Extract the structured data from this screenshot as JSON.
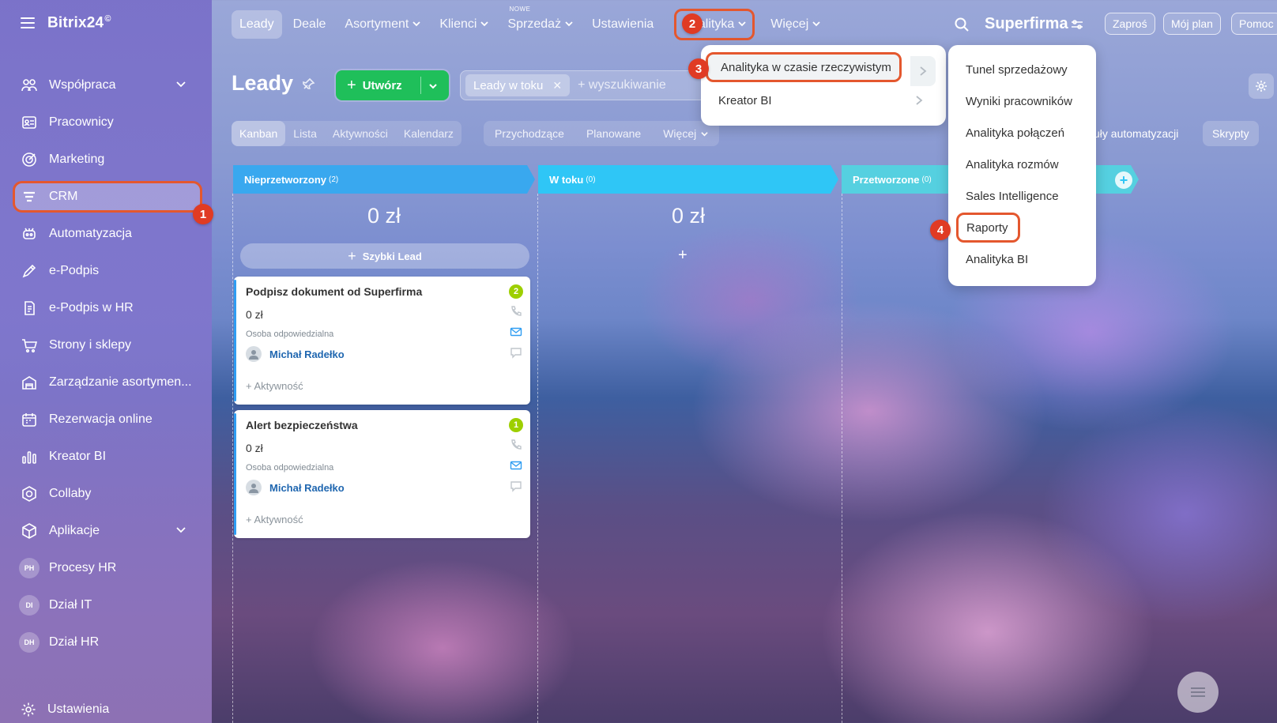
{
  "sidebar": {
    "brand": "Bitrix24",
    "brand_mark": "©",
    "items": [
      {
        "label": "Współpraca",
        "icon": "collaboration-icon",
        "has_chevron": true
      },
      {
        "label": "Pracownicy",
        "icon": "employees-icon"
      },
      {
        "label": "Marketing",
        "icon": "marketing-icon"
      },
      {
        "label": "CRM",
        "icon": "crm-icon",
        "active": true
      },
      {
        "label": "Automatyzacja",
        "icon": "automation-icon"
      },
      {
        "label": "e-Podpis",
        "icon": "signature-icon"
      },
      {
        "label": "e-Podpis w HR",
        "icon": "hr-signature-icon"
      },
      {
        "label": "Strony i sklepy",
        "icon": "cart-icon"
      },
      {
        "label": "Zarządzanie asortymen...",
        "icon": "inventory-icon"
      },
      {
        "label": "Rezerwacja online",
        "icon": "calendar-icon"
      },
      {
        "label": "Kreator BI",
        "icon": "bar-chart-icon"
      },
      {
        "label": "Collaby",
        "icon": "collaby-icon"
      },
      {
        "label": "Aplikacje",
        "icon": "apps-icon",
        "has_chevron": true
      },
      {
        "label": "Procesy HR",
        "initials": "PH"
      },
      {
        "label": "Dział IT",
        "initials": "DI"
      },
      {
        "label": "Dział HR",
        "initials": "DH"
      }
    ],
    "settings_label": "Ustawienia"
  },
  "steps": [
    "1",
    "2",
    "3",
    "4"
  ],
  "topnav": {
    "items": [
      "Leady",
      "Deale",
      "Asortyment",
      "Klienci",
      "Sprzedaż",
      "Ustawienia",
      "Analityka",
      "Więcej"
    ],
    "new_tag": "NOWE",
    "company": "Superfirma",
    "buttons": [
      "Zaproś",
      "Mój plan",
      "Pomoc"
    ]
  },
  "toolbar": {
    "title": "Leady",
    "create_label": "Utwórz",
    "filter_chip": "Leady w toku",
    "search_placeholder": "+ wyszukiwanie",
    "view_tabs": [
      "Kanban",
      "Lista",
      "Aktywności",
      "Kalendarz"
    ],
    "mode_tabs": [
      "Przychodzące",
      "Planowane",
      "Więcej"
    ],
    "automation_label": "uły automatyzacji",
    "scripts_label": "Skrypty"
  },
  "kanban": {
    "columns": [
      {
        "name": "Nieprzetworzony",
        "count": "(2)",
        "color": "#39a8ef",
        "sum": "0 zł"
      },
      {
        "name": "W toku",
        "count": "(0)",
        "color": "#2fc6f6",
        "sum": "0 zł"
      },
      {
        "name": "Przetworzone",
        "count": "(0)",
        "color": "#55d0e0"
      }
    ],
    "quick_lead": "Szybki Lead",
    "cards": [
      {
        "title": "Podpisz dokument od Superfirma",
        "badge": "2",
        "amount": "0 zł",
        "responsible_label": "Osoba odpowiedzialna",
        "user": "Michał Radełko",
        "activity": "+ Aktywność"
      },
      {
        "title": "Alert bezpieczeństwa",
        "badge": "1",
        "amount": "0 zł",
        "responsible_label": "Osoba odpowiedzialna",
        "user": "Michał Radełko",
        "activity": "+ Aktywność"
      }
    ]
  },
  "analytics_menu": {
    "items": [
      "Analityka w czasie rzeczywistym",
      "Kreator BI"
    ],
    "submenu": [
      "Tunel sprzedażowy",
      "Wyniki pracowników",
      "Analityka połączeń",
      "Analityka rozmów",
      "Sales Intelligence",
      "Raporty",
      "Analityka BI"
    ]
  },
  "colors": {
    "accent_green": "#1fbf5a",
    "highlight": "#e4572e",
    "step_badge": "#e03b24",
    "link_blue": "#2067b0"
  }
}
